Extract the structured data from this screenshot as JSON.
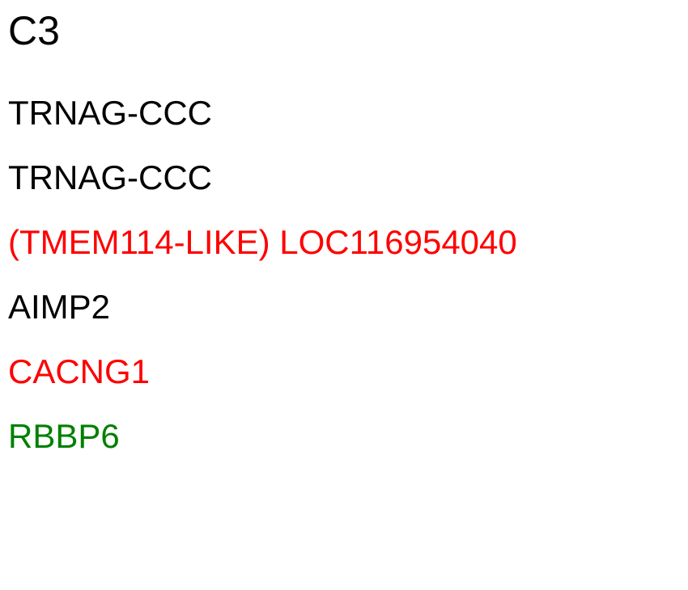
{
  "title": {
    "text": "C3",
    "color": "#000000"
  },
  "genes": [
    {
      "label": "TRNAG-CCC",
      "color": "#000000"
    },
    {
      "label": "TRNAG-CCC",
      "color": "#000000"
    },
    {
      "label": "(TMEM114-LIKE) LOC116954040",
      "color": "#ff0000"
    },
    {
      "label": "AIMP2",
      "color": "#000000"
    },
    {
      "label": "CACNG1",
      "color": "#ff0000"
    },
    {
      "label": "RBBP6",
      "color": "#008000"
    }
  ]
}
